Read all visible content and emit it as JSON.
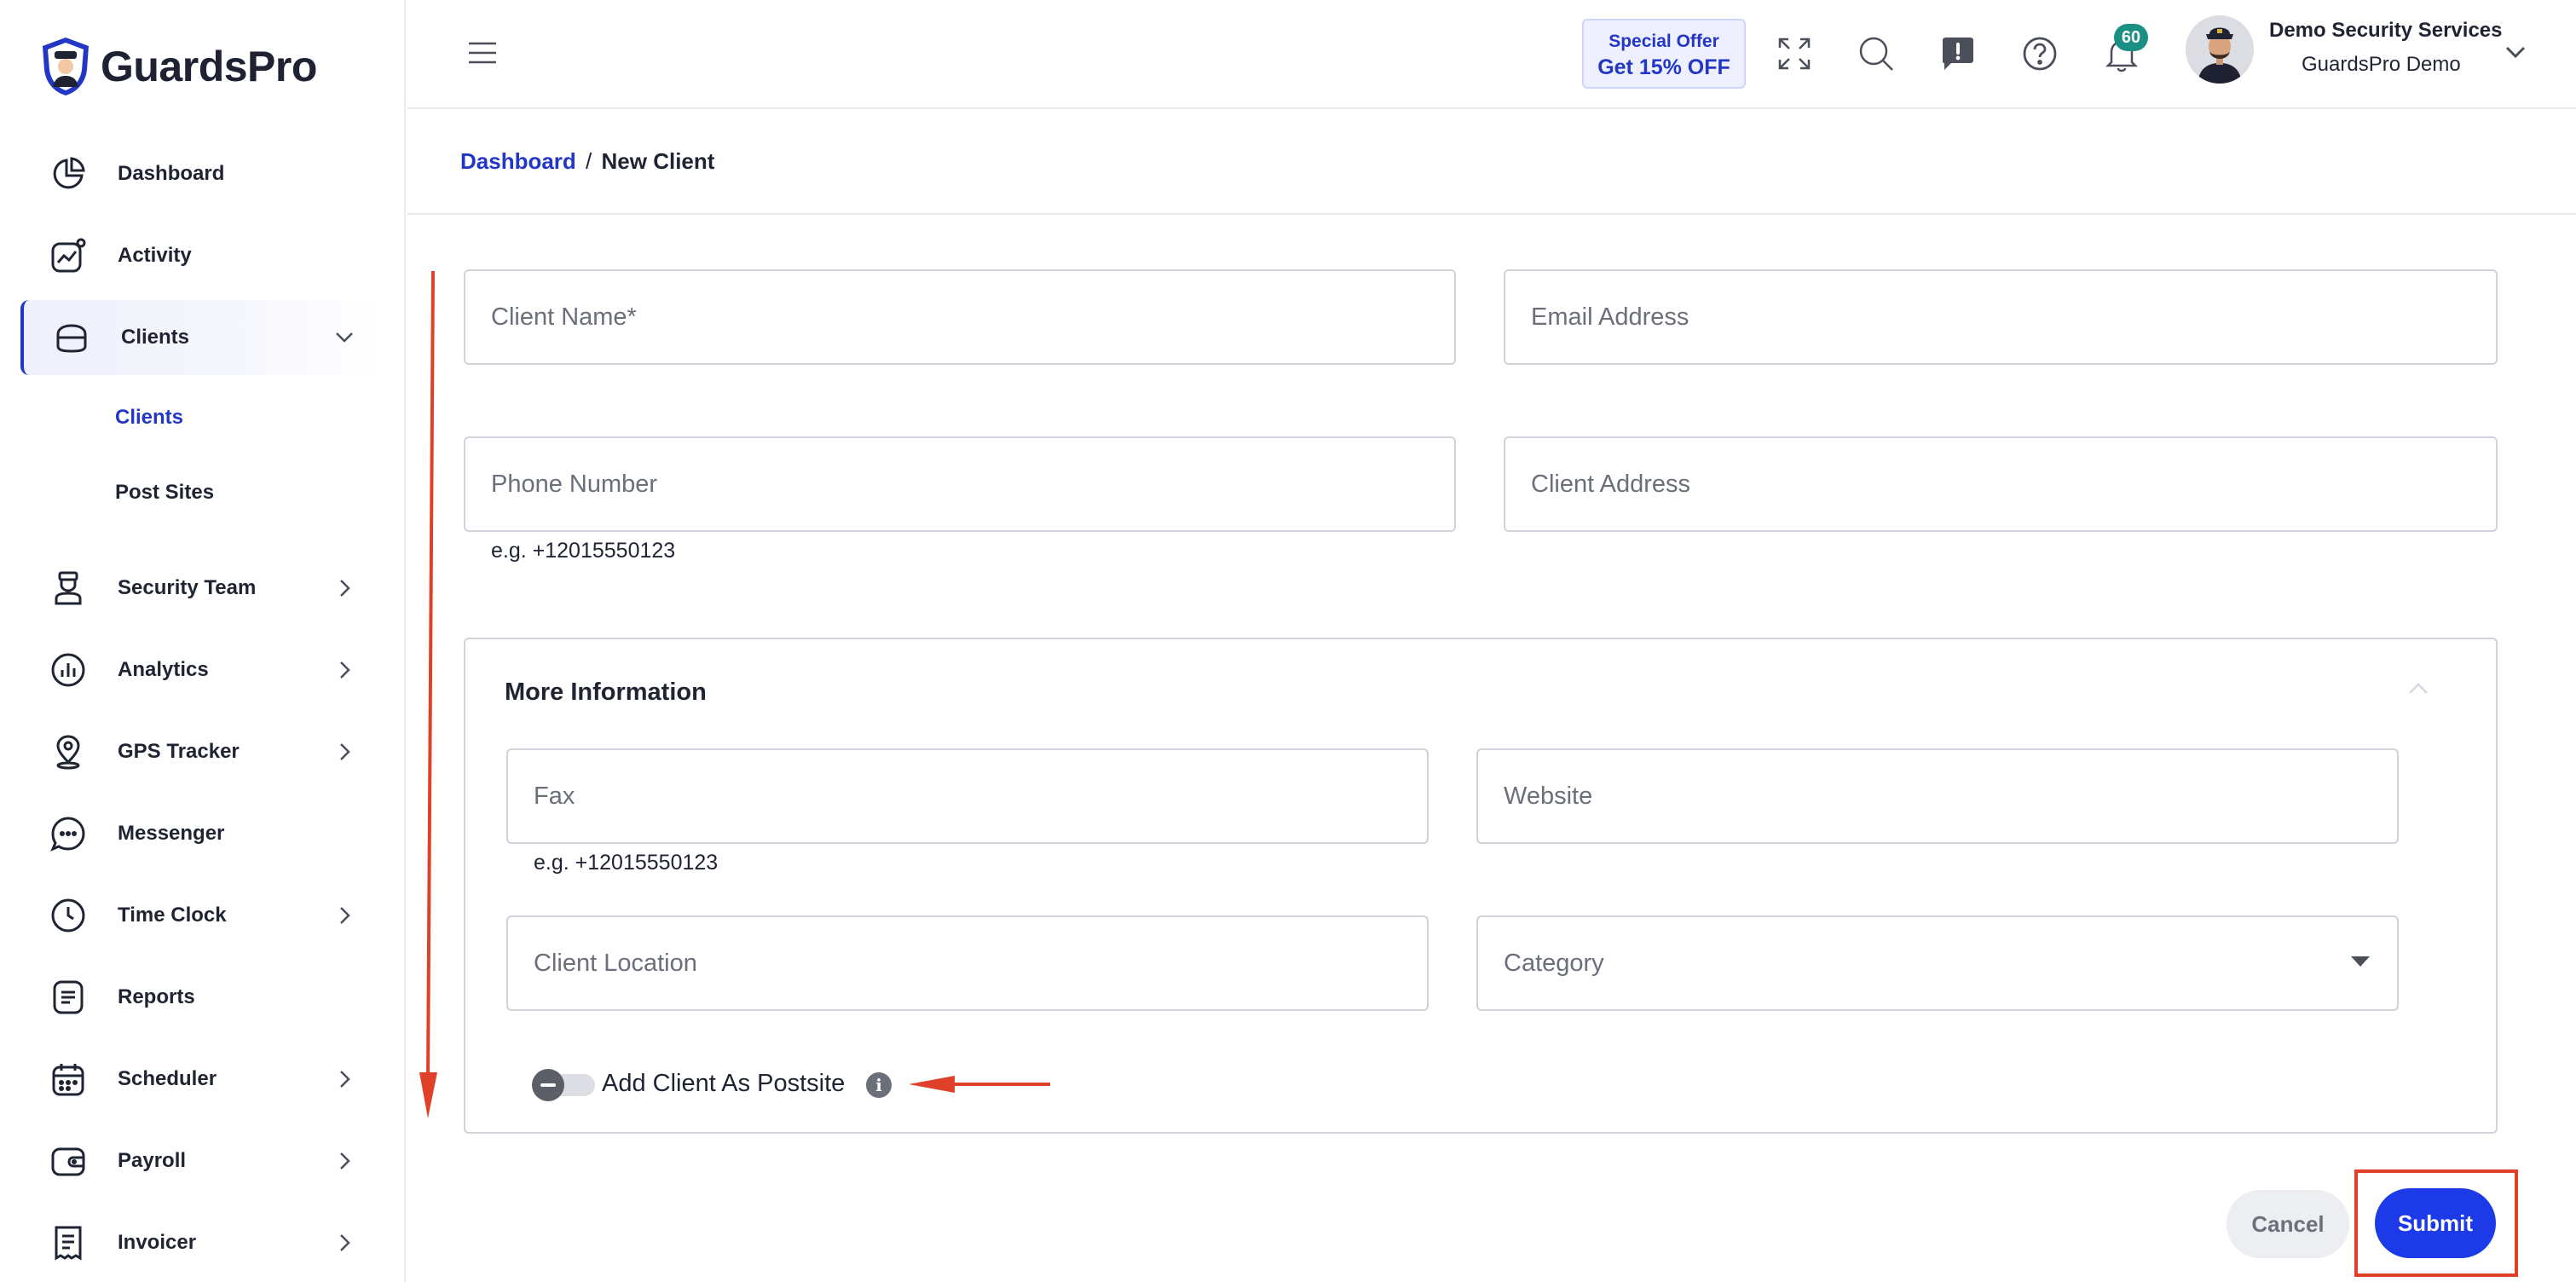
{
  "app": {
    "name": "GuardsPro"
  },
  "sidebar": {
    "items": [
      {
        "label": "Dashboard"
      },
      {
        "label": "Activity"
      },
      {
        "label": "Clients"
      },
      {
        "label": "Security Team"
      },
      {
        "label": "Analytics"
      },
      {
        "label": "GPS Tracker"
      },
      {
        "label": "Messenger"
      },
      {
        "label": "Time Clock"
      },
      {
        "label": "Reports"
      },
      {
        "label": "Scheduler"
      },
      {
        "label": "Payroll"
      },
      {
        "label": "Invoicer"
      }
    ],
    "clients_sub": [
      {
        "label": "Clients"
      },
      {
        "label": "Post Sites"
      }
    ]
  },
  "header": {
    "offer_line1": "Special Offer",
    "offer_line2": "Get 15% OFF",
    "notification_count": "60",
    "user_name": "Demo Security Services",
    "user_org": "GuardsPro Demo"
  },
  "breadcrumb": {
    "parent": "Dashboard",
    "separator": "/",
    "current": "New Client"
  },
  "form": {
    "client_name_placeholder": "Client Name*",
    "email_placeholder": "Email Address",
    "phone_placeholder": "Phone Number",
    "phone_hint": "e.g. +12015550123",
    "address_placeholder": "Client Address",
    "more_info_title": "More Information",
    "fax_placeholder": "Fax",
    "fax_hint": "e.g. +12015550123",
    "website_placeholder": "Website",
    "location_placeholder": "Client Location",
    "category_placeholder": "Category",
    "postsite_toggle_label": "Add Client As Postsite",
    "cancel_label": "Cancel",
    "submit_label": "Submit"
  },
  "colors": {
    "accent": "#2337c6",
    "submit": "#1d3ae8",
    "annotation": "#e0402a",
    "badge": "#1a8f84"
  }
}
